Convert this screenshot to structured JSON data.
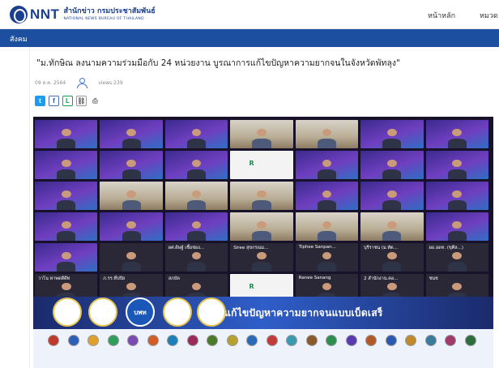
{
  "header": {
    "brand": "NNT",
    "org_thai": "สำนักข่าว กรมประชาสัมพันธ์",
    "org_eng": "NATIONAL NEWS BUREAU OF THAILAND",
    "nav": [
      "หน้าหลัก",
      "หมวด"
    ]
  },
  "section": {
    "label": "สังคม"
  },
  "article": {
    "headline": "\"ม.ทักษิณ ลงนามความร่วมมือกับ 24 หน่วยงาน บูรณาการแก้ไขปัญหาความยากจนในจังหวัดพัทลุง\"",
    "date": "09 ส.ค. 2564",
    "views": "views:239",
    "share_buttons": [
      {
        "icon": "twitter-icon",
        "glyph": "t"
      },
      {
        "icon": "facebook-icon",
        "glyph": "f"
      },
      {
        "icon": "line-icon",
        "glyph": "L"
      },
      {
        "icon": "link-icon",
        "glyph": "⛓"
      },
      {
        "icon": "print-icon",
        "glyph": "⎙"
      }
    ]
  },
  "video": {
    "banner_text": "เพื่อแก้ไขปัญหาความยากจนแบบเบ็ดเสร็",
    "seals": [
      "",
      "",
      "บพท",
      "",
      ""
    ],
    "tiles": [
      {
        "t": "purple",
        "name": ""
      },
      {
        "t": "purple",
        "name": ""
      },
      {
        "t": "purple",
        "name": ""
      },
      {
        "t": "room",
        "name": ""
      },
      {
        "t": "room",
        "name": ""
      },
      {
        "t": "purple",
        "name": ""
      },
      {
        "t": "purple",
        "name": ""
      },
      {
        "t": "purple",
        "name": ""
      },
      {
        "t": "purple",
        "name": ""
      },
      {
        "t": "purple",
        "name": ""
      },
      {
        "t": "logo",
        "name": ""
      },
      {
        "t": "purple",
        "name": ""
      },
      {
        "t": "purple",
        "name": ""
      },
      {
        "t": "purple",
        "name": ""
      },
      {
        "t": "purple",
        "name": ""
      },
      {
        "t": "room",
        "name": ""
      },
      {
        "t": "room",
        "name": ""
      },
      {
        "t": "room",
        "name": ""
      },
      {
        "t": "purple",
        "name": ""
      },
      {
        "t": "purple",
        "name": ""
      },
      {
        "t": "purple",
        "name": ""
      },
      {
        "t": "purple",
        "name": ""
      },
      {
        "t": "purple",
        "name": ""
      },
      {
        "t": "purple",
        "name": ""
      },
      {
        "t": "room",
        "name": ""
      },
      {
        "t": "room",
        "name": ""
      },
      {
        "t": "room",
        "name": ""
      },
      {
        "t": "purple",
        "name": ""
      },
      {
        "t": "purple",
        "name": ""
      },
      {
        "t": "dark",
        "name": ""
      },
      {
        "t": "dark",
        "name": "ผศ.ดิษฐ์ เชื้อช่อง..."
      },
      {
        "t": "dark",
        "name": "Siree สุขกรณม..."
      },
      {
        "t": "dark",
        "name": "Tiphee Sanpan..."
      },
      {
        "t": "dark",
        "name": "บุรีราชน (ม.ทัต..."
      },
      {
        "t": "dark",
        "name": "ผอ.อดท. (ขุศิล...)"
      },
      {
        "t": "dark",
        "name": "วาโน พ่าพดดีดีท"
      },
      {
        "t": "dark",
        "name": "ภ.รร.ที่ปปัย"
      },
      {
        "t": "dark",
        "name": "สภบัด"
      },
      {
        "t": "logo",
        "name": ""
      },
      {
        "t": "dark",
        "name": "Ranee Sanang"
      },
      {
        "t": "dark",
        "name": "2 สำนักงาน.คอ..."
      },
      {
        "t": "dark",
        "name": "ชนช"
      }
    ]
  }
}
